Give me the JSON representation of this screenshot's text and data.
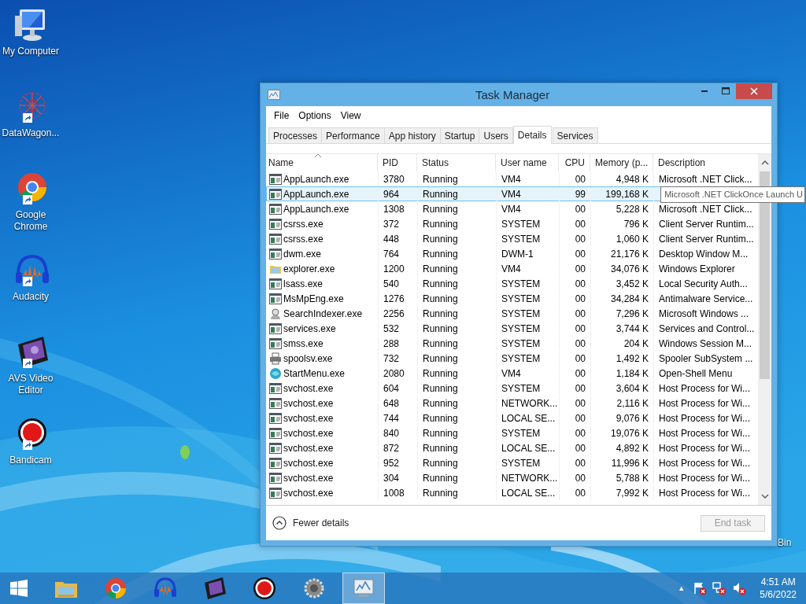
{
  "desktop_icons": [
    {
      "kind": "computer",
      "label": "My Computer",
      "shortcut": false
    },
    {
      "kind": "datawagon",
      "label": "DataWagon...",
      "shortcut": true
    },
    {
      "kind": "chrome",
      "label": "Google Chrome",
      "shortcut": true
    },
    {
      "kind": "audacity",
      "label": "Audacity",
      "shortcut": true
    },
    {
      "kind": "avs",
      "label": "AVS Video Editor",
      "shortcut": true
    },
    {
      "kind": "bandicam",
      "label": "Bandicam",
      "shortcut": true
    }
  ],
  "desktop_partial_label": "Bin",
  "window": {
    "title": "Task Manager",
    "menu": [
      "File",
      "Options",
      "View"
    ],
    "tabs": [
      {
        "label": "Processes",
        "selected": false
      },
      {
        "label": "Performance",
        "selected": false
      },
      {
        "label": "App history",
        "selected": false
      },
      {
        "label": "Startup",
        "selected": false
      },
      {
        "label": "Users",
        "selected": false
      },
      {
        "label": "Details",
        "selected": true
      },
      {
        "label": "Services",
        "selected": false
      }
    ],
    "table": {
      "columns": [
        {
          "label": "Name",
          "sorted": true
        },
        {
          "label": "PID",
          "sorted": false
        },
        {
          "label": "Status",
          "sorted": false
        },
        {
          "label": "User name",
          "sorted": false
        },
        {
          "label": "CPU",
          "sorted": false
        },
        {
          "label": "Memory (p...",
          "sorted": false
        },
        {
          "label": "Description",
          "sorted": false
        }
      ],
      "rows": [
        {
          "kind": "app",
          "name": "AppLaunch.exe",
          "pid": "3780",
          "status": "Running",
          "user": "VM4",
          "cpu": "00",
          "memory": "4,948 K",
          "description": "Microsoft .NET Click...",
          "selected": false
        },
        {
          "kind": "app",
          "name": "AppLaunch.exe",
          "pid": "964",
          "status": "Running",
          "user": "VM4",
          "cpu": "99",
          "memory": "199,168 K",
          "description": "",
          "selected": true
        },
        {
          "kind": "app",
          "name": "AppLaunch.exe",
          "pid": "1308",
          "status": "Running",
          "user": "VM4",
          "cpu": "00",
          "memory": "5,228 K",
          "description": "Microsoft .NET Click...",
          "selected": false
        },
        {
          "kind": "app",
          "name": "csrss.exe",
          "pid": "372",
          "status": "Running",
          "user": "SYSTEM",
          "cpu": "00",
          "memory": "796 K",
          "description": "Client Server Runtim...",
          "selected": false
        },
        {
          "kind": "app",
          "name": "csrss.exe",
          "pid": "448",
          "status": "Running",
          "user": "SYSTEM",
          "cpu": "00",
          "memory": "1,060 K",
          "description": "Client Server Runtim...",
          "selected": false
        },
        {
          "kind": "app",
          "name": "dwm.exe",
          "pid": "764",
          "status": "Running",
          "user": "DWM-1",
          "cpu": "00",
          "memory": "21,176 K",
          "description": "Desktop Window M...",
          "selected": false
        },
        {
          "kind": "folder",
          "name": "explorer.exe",
          "pid": "1200",
          "status": "Running",
          "user": "VM4",
          "cpu": "00",
          "memory": "34,076 K",
          "description": "Windows Explorer",
          "selected": false
        },
        {
          "kind": "app",
          "name": "lsass.exe",
          "pid": "540",
          "status": "Running",
          "user": "SYSTEM",
          "cpu": "00",
          "memory": "3,452 K",
          "description": "Local Security Auth...",
          "selected": false
        },
        {
          "kind": "app",
          "name": "MsMpEng.exe",
          "pid": "1276",
          "status": "Running",
          "user": "SYSTEM",
          "cpu": "00",
          "memory": "34,284 K",
          "description": "Antimalware Service...",
          "selected": false
        },
        {
          "kind": "search",
          "name": "SearchIndexer.exe",
          "pid": "2256",
          "status": "Running",
          "user": "SYSTEM",
          "cpu": "00",
          "memory": "7,296 K",
          "description": "Microsoft Windows ...",
          "selected": false
        },
        {
          "kind": "app",
          "name": "services.exe",
          "pid": "532",
          "status": "Running",
          "user": "SYSTEM",
          "cpu": "00",
          "memory": "3,744 K",
          "description": "Services and Control...",
          "selected": false
        },
        {
          "kind": "app",
          "name": "smss.exe",
          "pid": "288",
          "status": "Running",
          "user": "SYSTEM",
          "cpu": "00",
          "memory": "204 K",
          "description": "Windows Session M...",
          "selected": false
        },
        {
          "kind": "printer",
          "name": "spoolsv.exe",
          "pid": "732",
          "status": "Running",
          "user": "SYSTEM",
          "cpu": "00",
          "memory": "1,492 K",
          "description": "Spooler SubSystem ...",
          "selected": false
        },
        {
          "kind": "shell",
          "name": "StartMenu.exe",
          "pid": "2080",
          "status": "Running",
          "user": "VM4",
          "cpu": "00",
          "memory": "1,184 K",
          "description": "Open-Shell Menu",
          "selected": false
        },
        {
          "kind": "app",
          "name": "svchost.exe",
          "pid": "604",
          "status": "Running",
          "user": "SYSTEM",
          "cpu": "00",
          "memory": "3,604 K",
          "description": "Host Process for Wi...",
          "selected": false
        },
        {
          "kind": "app",
          "name": "svchost.exe",
          "pid": "648",
          "status": "Running",
          "user": "NETWORK...",
          "cpu": "00",
          "memory": "2,116 K",
          "description": "Host Process for Wi...",
          "selected": false
        },
        {
          "kind": "app",
          "name": "svchost.exe",
          "pid": "744",
          "status": "Running",
          "user": "LOCAL SE...",
          "cpu": "00",
          "memory": "9,076 K",
          "description": "Host Process for Wi...",
          "selected": false
        },
        {
          "kind": "app",
          "name": "svchost.exe",
          "pid": "840",
          "status": "Running",
          "user": "SYSTEM",
          "cpu": "00",
          "memory": "19,076 K",
          "description": "Host Process for Wi...",
          "selected": false
        },
        {
          "kind": "app",
          "name": "svchost.exe",
          "pid": "872",
          "status": "Running",
          "user": "LOCAL SE...",
          "cpu": "00",
          "memory": "4,892 K",
          "description": "Host Process for Wi...",
          "selected": false
        },
        {
          "kind": "app",
          "name": "svchost.exe",
          "pid": "952",
          "status": "Running",
          "user": "SYSTEM",
          "cpu": "00",
          "memory": "11,996 K",
          "description": "Host Process for Wi...",
          "selected": false
        },
        {
          "kind": "app",
          "name": "svchost.exe",
          "pid": "304",
          "status": "Running",
          "user": "NETWORK...",
          "cpu": "00",
          "memory": "5,788 K",
          "description": "Host Process for Wi...",
          "selected": false
        },
        {
          "kind": "app",
          "name": "svchost.exe",
          "pid": "1008",
          "status": "Running",
          "user": "LOCAL SE...",
          "cpu": "00",
          "memory": "7,992 K",
          "description": "Host Process for Wi...",
          "selected": false
        }
      ]
    },
    "tooltip": "Microsoft .NET ClickOnce Launch U",
    "fewer_details": "Fewer details",
    "end_task": {
      "label": "End task",
      "disabled": true
    }
  },
  "taskbar": {
    "apps": [
      {
        "kind": "explorer",
        "active": false
      },
      {
        "kind": "chrome",
        "active": false
      },
      {
        "kind": "audacity",
        "active": false
      },
      {
        "kind": "avs",
        "active": false
      },
      {
        "kind": "bandicam",
        "active": false
      },
      {
        "kind": "gear",
        "active": false
      },
      {
        "kind": "taskmanager",
        "active": true
      }
    ],
    "tray_caret": "▲",
    "time": "4:51 AM",
    "date": "5/6/2022"
  }
}
